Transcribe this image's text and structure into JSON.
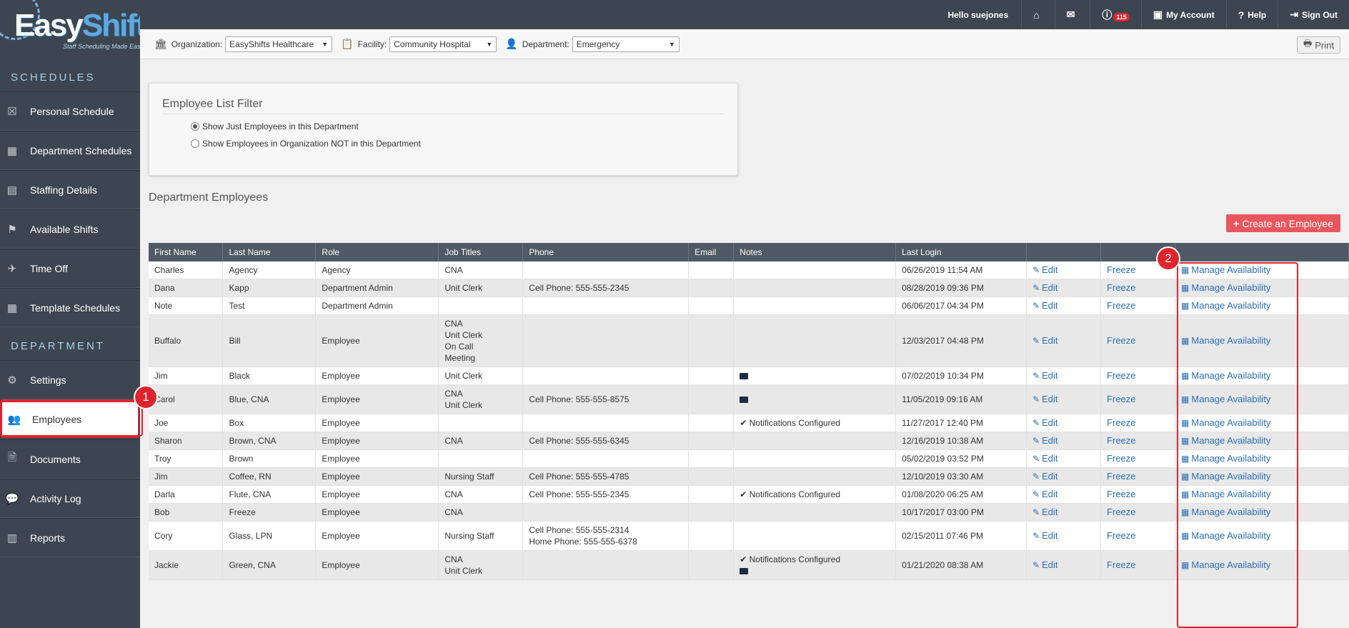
{
  "app": {
    "brand_easy": "Easy",
    "brand_shifts": "Shifts",
    "tagline": "Staff Scheduling Made Easy"
  },
  "topbar": {
    "hello": "Hello suejones",
    "notification_count": "115",
    "my_account": "My Account",
    "help": "Help",
    "sign_out": "Sign Out"
  },
  "sidebar": {
    "schedules_heading": "SCHEDULES",
    "department_heading": "DEPARTMENT",
    "schedule_items": [
      {
        "label": "Personal Schedule"
      },
      {
        "label": "Department Schedules"
      },
      {
        "label": "Staffing Details"
      },
      {
        "label": "Available Shifts"
      },
      {
        "label": "Time Off"
      },
      {
        "label": "Template Schedules"
      }
    ],
    "department_items": [
      {
        "label": "Settings"
      },
      {
        "label": "Employees"
      },
      {
        "label": "Documents"
      },
      {
        "label": "Activity Log"
      },
      {
        "label": "Reports"
      }
    ]
  },
  "filters": {
    "organization_label": "Organization:",
    "organization_value": "EasyShifts Healthcare",
    "facility_label": "Facility:",
    "facility_value": "Community Hospital",
    "department_label": "Department:",
    "department_value": "Emergency",
    "print_label": "Print"
  },
  "filter_panel": {
    "title": "Employee List Filter",
    "option_1": "Show Just Employees in this Department",
    "option_2": "Show Employees in Organization NOT in this Department",
    "selected": 1
  },
  "section_title": "Department Employees",
  "create_button": "Create an Employee",
  "markers": {
    "one": "1",
    "two": "2"
  },
  "table": {
    "headers": [
      "First Name",
      "Last Name",
      "Role",
      "Job Titles",
      "Phone",
      "Email",
      "Notes",
      "Last Login",
      "",
      "",
      ""
    ],
    "edit_label": "Edit",
    "freeze_label": "Freeze",
    "manage_label": "Manage Availability",
    "rows": [
      {
        "first": "Charles",
        "last": "Agency",
        "role": "Agency",
        "jobs": [
          "CNA"
        ],
        "phone": [],
        "email": "",
        "notes_text": "",
        "notes_email": false,
        "login": "06/26/2019 11:54 AM"
      },
      {
        "first": "Dana",
        "last": "Kapp",
        "role": "Department Admin",
        "jobs": [
          "Unit Clerk"
        ],
        "phone": [
          "Cell Phone: 555-555-2345"
        ],
        "email": "",
        "notes_text": "",
        "notes_email": false,
        "login": "08/28/2019 09:36 PM"
      },
      {
        "first": "Note",
        "last": "Test",
        "role": "Department Admin",
        "jobs": [],
        "phone": [],
        "email": "",
        "notes_text": "",
        "notes_email": false,
        "login": "06/06/2017 04:34 PM"
      },
      {
        "first": "Buffalo",
        "last": "Bill",
        "role": "Employee",
        "jobs": [
          "CNA",
          "Unit Clerk",
          "On Call",
          "Meeting"
        ],
        "phone": [],
        "email": "",
        "notes_text": "",
        "notes_email": false,
        "login": "12/03/2017 04:48 PM"
      },
      {
        "first": "Jim",
        "last": "Black",
        "role": "Employee",
        "jobs": [
          "Unit Clerk"
        ],
        "phone": [],
        "email": "",
        "notes_text": "",
        "notes_email": true,
        "login": "07/02/2019 10:34 PM"
      },
      {
        "first": "Carol",
        "last": "Blue, CNA",
        "role": "Employee",
        "jobs": [
          "CNA",
          "Unit Clerk"
        ],
        "phone": [
          "Cell Phone: 555-555-8575"
        ],
        "email": "",
        "notes_text": "",
        "notes_email": true,
        "login": "11/05/2019 09:16 AM"
      },
      {
        "first": "Joe",
        "last": "Box",
        "role": "Employee",
        "jobs": [],
        "phone": [],
        "email": "",
        "notes_text": "Notifications Configured",
        "notes_email": false,
        "login": "11/27/2017 12:40 PM"
      },
      {
        "first": "Sharon",
        "last": "Brown, CNA",
        "role": "Employee",
        "jobs": [
          "CNA"
        ],
        "phone": [
          "Cell Phone: 555-555-6345"
        ],
        "email": "",
        "notes_text": "",
        "notes_email": false,
        "login": "12/16/2019 10:38 AM"
      },
      {
        "first": "Troy",
        "last": "Brown",
        "role": "Employee",
        "jobs": [],
        "phone": [],
        "email": "",
        "notes_text": "",
        "notes_email": false,
        "login": "05/02/2019 03:52 PM"
      },
      {
        "first": "Jim",
        "last": "Coffee, RN",
        "role": "Employee",
        "jobs": [
          "Nursing Staff"
        ],
        "phone": [
          "Cell Phone: 555-555-4785"
        ],
        "email": "",
        "notes_text": "",
        "notes_email": false,
        "login": "12/10/2019 03:30 AM"
      },
      {
        "first": "Darla",
        "last": "Flute, CNA",
        "role": "Employee",
        "jobs": [
          "CNA"
        ],
        "phone": [
          "Cell Phone: 555-555-2345"
        ],
        "email": "",
        "notes_text": "Notifications Configured",
        "notes_email": false,
        "login": "01/08/2020 06:25 AM"
      },
      {
        "first": "Bob",
        "last": "Freeze",
        "role": "Employee",
        "jobs": [
          "CNA"
        ],
        "phone": [],
        "email": "",
        "notes_text": "",
        "notes_email": false,
        "login": "10/17/2017 03:00 PM"
      },
      {
        "first": "Cory",
        "last": "Glass, LPN",
        "role": "Employee",
        "jobs": [
          "Nursing Staff"
        ],
        "phone": [
          "Cell Phone: 555-555-2314",
          "Home Phone: 555-555-6378"
        ],
        "email": "",
        "notes_text": "",
        "notes_email": false,
        "login": "02/15/2011 07:46 PM"
      },
      {
        "first": "Jackie",
        "last": "Green, CNA",
        "role": "Employee",
        "jobs": [
          "CNA",
          "Unit Clerk"
        ],
        "phone": [],
        "email": "",
        "notes_text": "Notifications Configured",
        "notes_email": true,
        "login": "01/21/2020 08:38 AM"
      }
    ]
  },
  "colors": {
    "sidebar_bg": "#3d4650",
    "accent_blue": "#2a6fb4",
    "create_red": "#e9575e",
    "highlight_red": "#e0242e"
  }
}
